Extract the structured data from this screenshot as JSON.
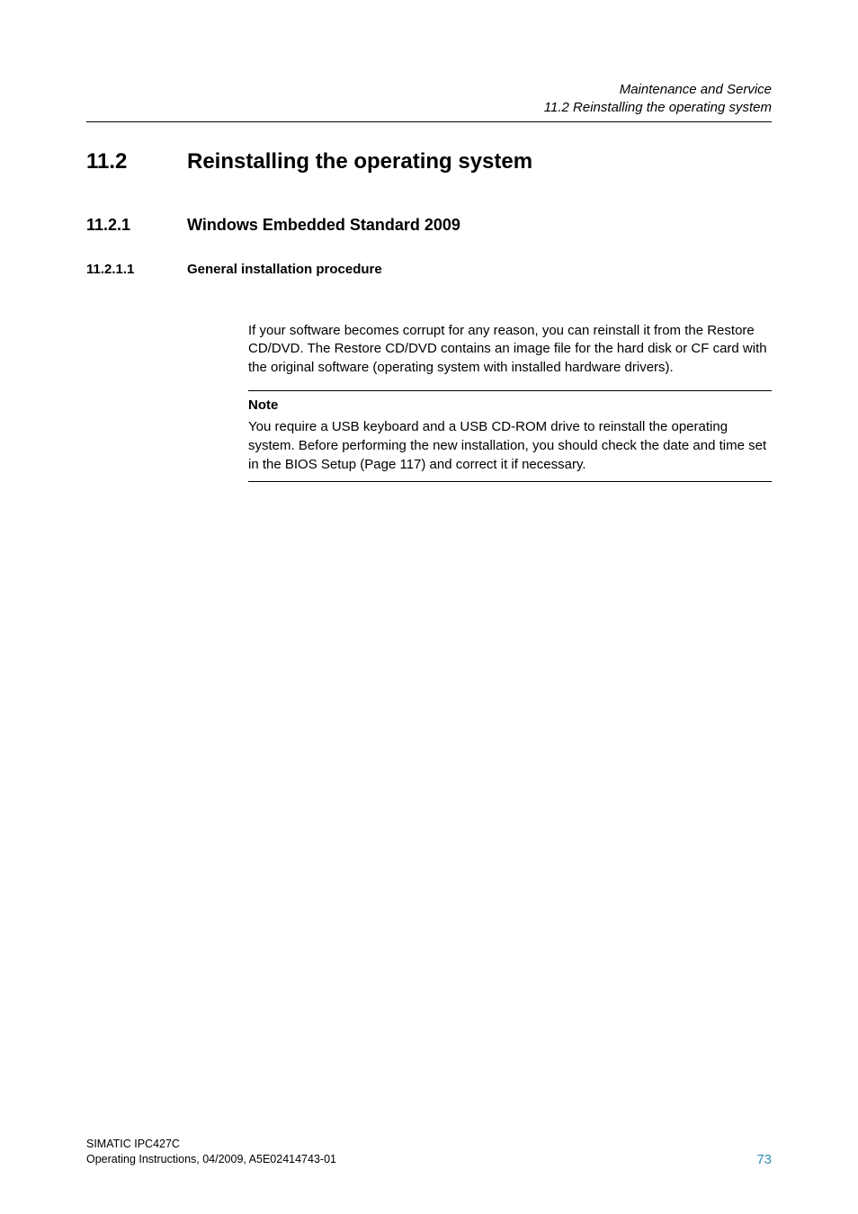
{
  "running_header": {
    "chapter": "Maintenance and Service",
    "section": "11.2 Reinstalling the operating system"
  },
  "h1": {
    "number": "11.2",
    "title": "Reinstalling the operating system"
  },
  "h2": {
    "number": "11.2.1",
    "title": "Windows Embedded Standard 2009"
  },
  "h3": {
    "number": "11.2.1.1",
    "title": "General installation procedure"
  },
  "body": {
    "para1": "If your software becomes corrupt for any reason, you can reinstall it from the Restore CD/DVD. The Restore CD/DVD contains an image file for the hard disk or CF card with the original software (operating system with installed hardware drivers)."
  },
  "note": {
    "label": "Note",
    "before_link": "You require a USB keyboard and a USB CD-ROM drive to reinstall the operating system. Before performing the new installation, you should check the date and time set in the ",
    "link_bios": "BIOS Setup",
    "mid": " (Page ",
    "link_page": "117",
    "after_link": ") and correct it if necessary."
  },
  "footer": {
    "product": "SIMATIC IPC427C",
    "meta": "Operating Instructions, 04/2009, A5E02414743-01",
    "page": "73"
  }
}
